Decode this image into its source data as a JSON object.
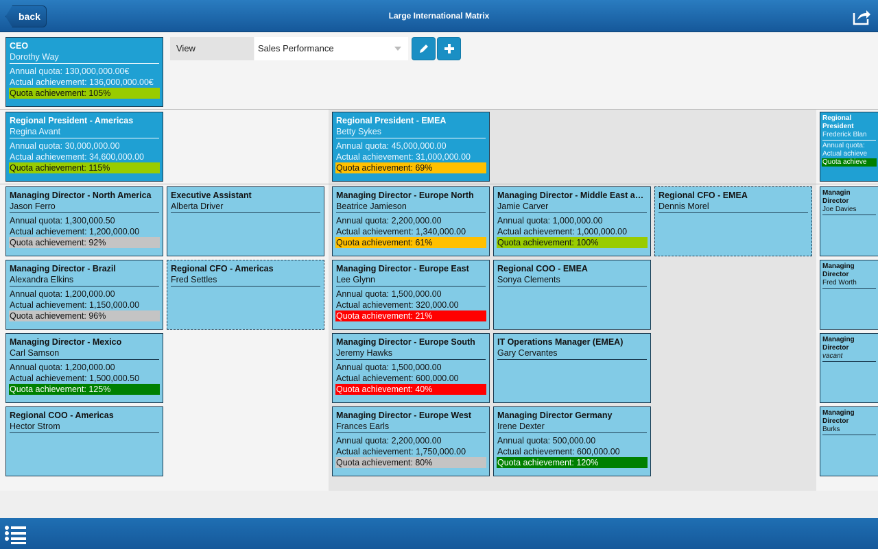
{
  "header": {
    "back_label": "back",
    "title": "Large International Matrix",
    "share_icon": "share-icon"
  },
  "toolbar": {
    "view_label": "View",
    "view_value": "Sales Performance",
    "edit_icon": "pencil-icon",
    "add_icon": "plus-icon"
  },
  "footer": {
    "list_icon": "list-icon"
  },
  "colors": {
    "lime": "#99cc00",
    "amber": "#ffc000",
    "red": "#ff0000",
    "gray": "#c4c4c4",
    "green": "#008000"
  },
  "cards": [
    {
      "style": "top",
      "role": "CEO",
      "name": "Dorothy Way",
      "quota": "Annual quota: 130,000,000.00€",
      "actual": "Actual achievement: 136,000,000.00€",
      "achievement": "Quota achievement: 105%",
      "status": "lime"
    },
    {
      "style": "top",
      "role": "Regional President - Americas",
      "name": "Regina Avant",
      "quota": "Annual quota: 30,000,000.00",
      "actual": "Actual achievement: 34,600,000.00",
      "achievement": "Quota achievement: 115%",
      "status": "lime"
    },
    {
      "style": "top",
      "role": "Regional President - EMEA",
      "name": "Betty Sykes",
      "quota": "Annual quota: 45,000,000.00",
      "actual": "Actual achievement: 31,000,000.00",
      "achievement": "Quota achievement: 69%",
      "status": "amber"
    },
    {
      "style": "top",
      "role": "Regional President",
      "name": "Frederick Blan",
      "quota": "Annual quota:",
      "actual": "Actual achieve",
      "achievement": "Quota achieve",
      "status": "green"
    },
    {
      "style": "low",
      "role": "Managing Director - North America",
      "name": "Jason Ferro",
      "quota": "Annual quota: 1,300,000.50",
      "actual": "Actual achievement: 1,200,000.00",
      "achievement": "Quota achievement: 92%",
      "status": "gray"
    },
    {
      "style": "low",
      "role": "Executive Assistant",
      "name": "Alberta Driver"
    },
    {
      "style": "low",
      "role": "Managing Director - Europe North",
      "name": "Beatrice Jamieson",
      "quota": "Annual quota: 2,200,000.00",
      "actual": "Actual achievement: 1,340,000.00",
      "achievement": "Quota achievement: 61%",
      "status": "amber"
    },
    {
      "style": "low",
      "role": "Managing Director - Middle East and Africa",
      "name": "Jamie Carver",
      "quota": "Annual quota: 1,000,000.00",
      "actual": "Actual achievement: 1,000,000.00",
      "achievement": "Quota achievement: 100%",
      "status": "lime"
    },
    {
      "style": "low",
      "dashed": true,
      "role": "Regional CFO - EMEA",
      "name": "Dennis Morel"
    },
    {
      "style": "low",
      "role": "Managin Director",
      "name": "Joe Davies"
    },
    {
      "style": "low",
      "role": "Managing Director - Brazil",
      "name": "Alexandra Elkins",
      "quota": "Annual quota: 1,200,000.00",
      "actual": "Actual achievement: 1,150,000.00",
      "achievement": "Quota achievement: 96%",
      "status": "gray"
    },
    {
      "style": "low",
      "dashed": true,
      "role": "Regional CFO - Americas",
      "name": "Fred Settles"
    },
    {
      "style": "low",
      "role": "Managing Director - Europe East",
      "name": "Lee Glynn",
      "quota": "Annual quota: 1,500,000.00",
      "actual": "Actual achievement: 320,000.00",
      "achievement": "Quota achievement: 21%",
      "status": "red"
    },
    {
      "style": "low",
      "role": "Regional COO - EMEA",
      "name": "Sonya Clements"
    },
    {
      "style": "low",
      "role": "Managing Director",
      "name": "Fred Worth"
    },
    {
      "style": "low",
      "role": "Managing Director - Mexico",
      "name": "Carl Samson",
      "quota": "Annual quota: 1,200,000.00",
      "actual": "Actual achievement: 1,500,000.50",
      "achievement": "Quota achievement: 125%",
      "status": "green"
    },
    {
      "style": "low",
      "role": "Managing Director - Europe South",
      "name": "Jeremy Hawks",
      "quota": "Annual quota: 1,500,000.00",
      "actual": "Actual achievement: 600,000.00",
      "achievement": "Quota achievement: 40%",
      "status": "red"
    },
    {
      "style": "low",
      "role": "IT Operations Manager (EMEA)",
      "name": "Gary Cervantes"
    },
    {
      "style": "low",
      "role": "Managing Director",
      "name": "vacant",
      "vacant": true
    },
    {
      "style": "low",
      "role": "Regional COO - Americas",
      "name": "Hector Strom"
    },
    {
      "style": "low",
      "role": "Managing Director - Europe West",
      "name": "Frances Earls",
      "quota": "Annual quota: 2,200,000.00",
      "actual": "Actual achievement: 1,750,000.00",
      "achievement": "Quota achievement: 80%",
      "status": "gray"
    },
    {
      "style": "low",
      "role": "Managing Director Germany",
      "name": "Irene Dexter",
      "quota": "Annual quota: 500,000.00",
      "actual": "Actual achievement: 600,000.00",
      "achievement": "Quota achievement: 120%",
      "status": "green"
    },
    {
      "style": "low",
      "role": "Managing Director",
      "name": "Burks"
    }
  ]
}
